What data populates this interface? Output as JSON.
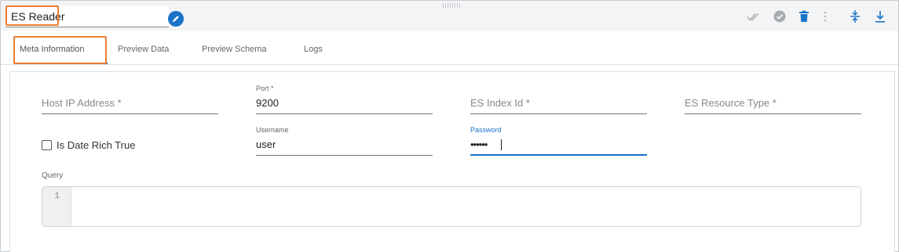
{
  "header": {
    "name_value": "ES Reader",
    "icons": [
      "edit-icon",
      "double-check-icon",
      "check-circle-icon",
      "delete-icon",
      "more-vertical-icon",
      "collapse-icon",
      "download-icon"
    ]
  },
  "tabs": [
    {
      "label": "Meta Information",
      "active": true
    },
    {
      "label": "Preview Data",
      "active": false
    },
    {
      "label": "Preview Schema",
      "active": false
    },
    {
      "label": "Logs",
      "active": false
    }
  ],
  "form": {
    "host_ip": {
      "placeholder": "Host IP Address *",
      "value": ""
    },
    "port": {
      "label": "Port *",
      "value": "9200"
    },
    "es_index_id": {
      "placeholder": "ES Index Id *",
      "value": ""
    },
    "es_resource_type": {
      "placeholder": "ES Resource Type *",
      "value": ""
    },
    "is_date_rich_true": {
      "label": "Is Date Rich True",
      "checked": false
    },
    "username": {
      "label": "Username",
      "value": "user"
    },
    "password": {
      "label": "Password",
      "value": "••••••"
    },
    "query": {
      "label": "Query",
      "line_number": "1",
      "value": ""
    }
  },
  "colors": {
    "accent": "#1a73c8",
    "highlight": "#ed7d31",
    "delete": "#1a73c8",
    "muted_icon": "#a8abaf"
  }
}
